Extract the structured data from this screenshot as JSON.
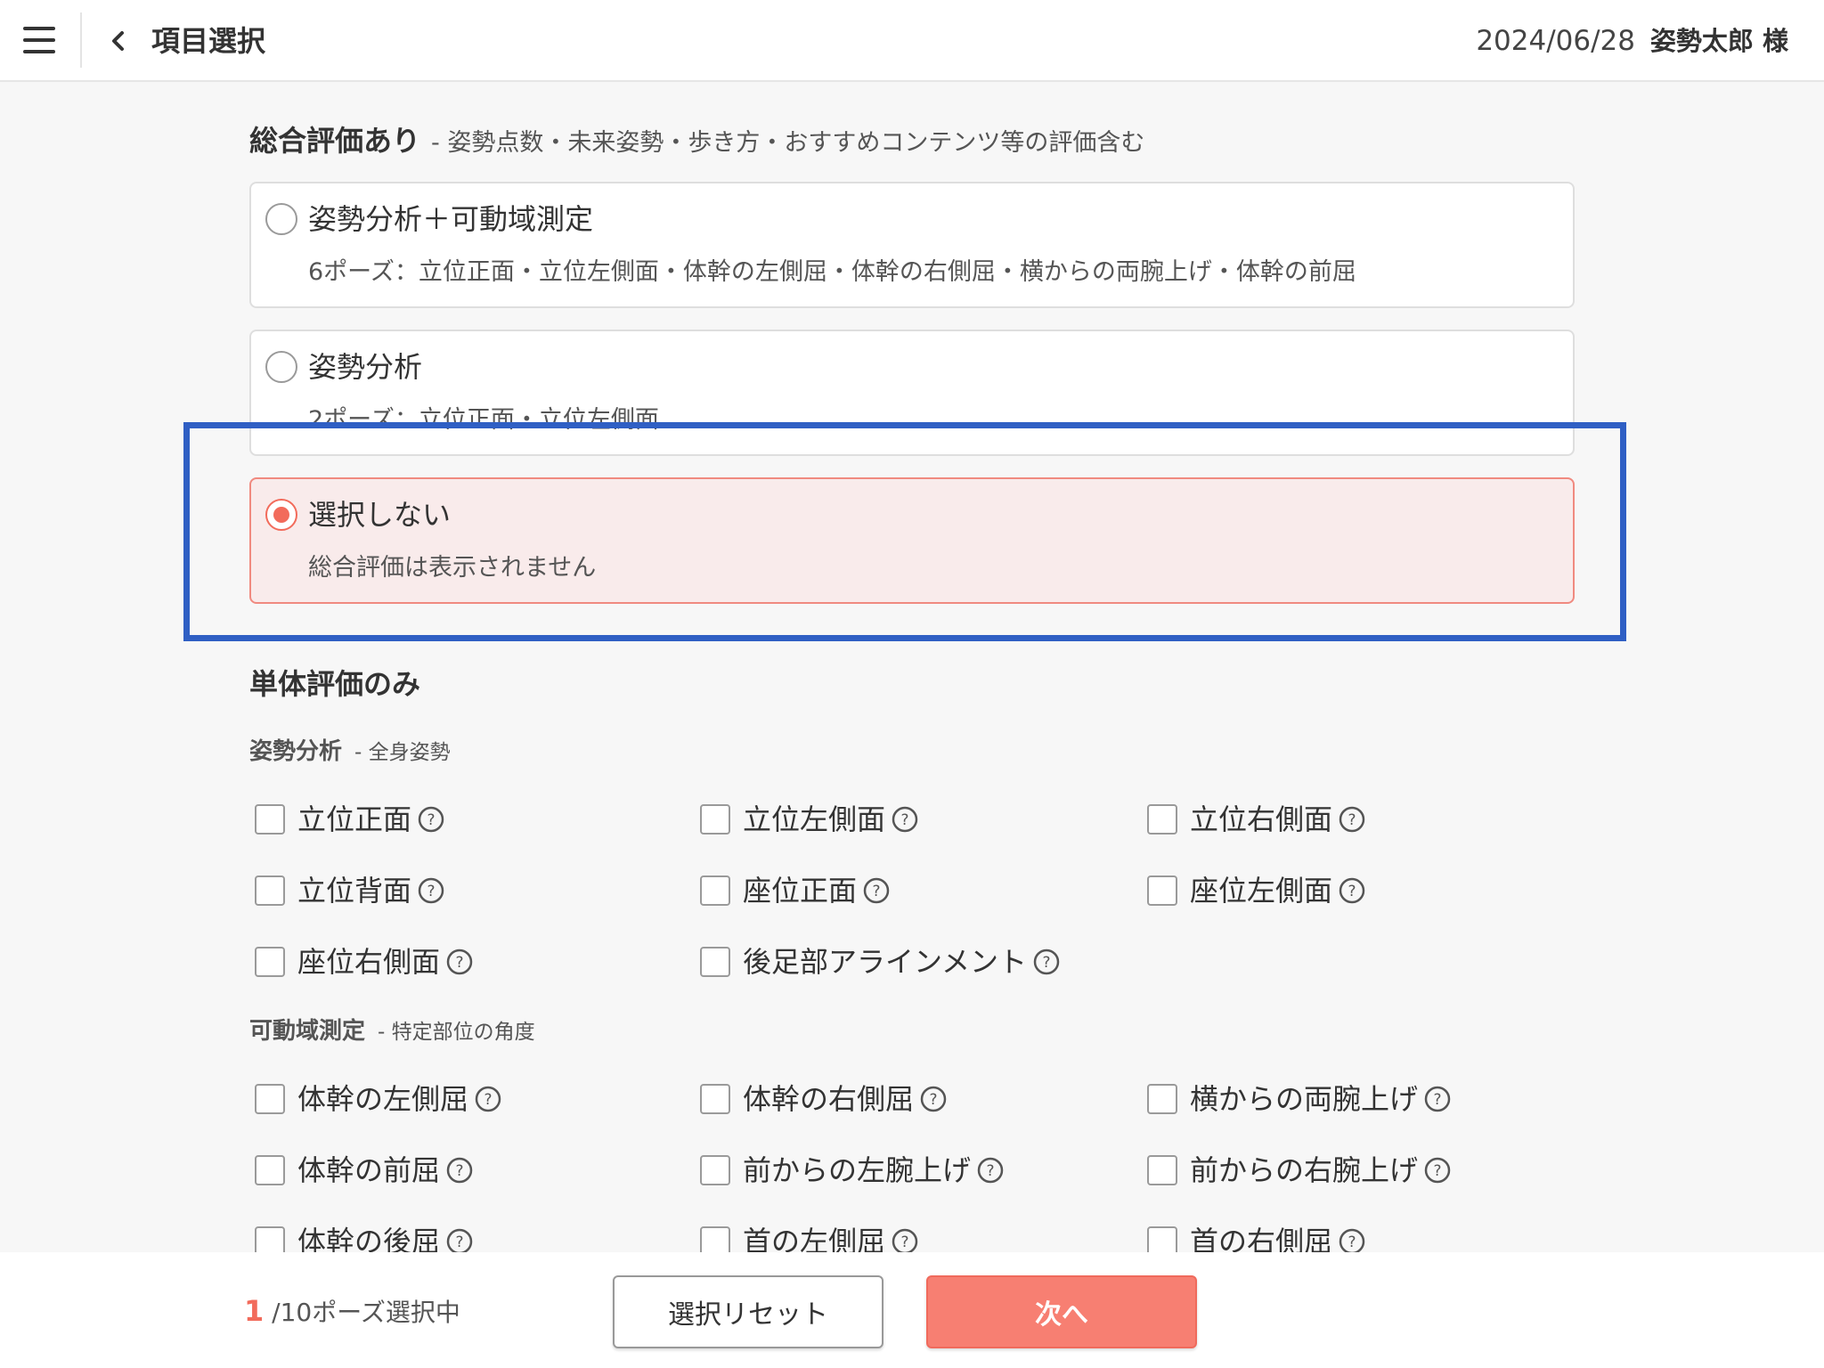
{
  "header": {
    "title": "項目選択",
    "date": "2024/06/28",
    "user": "姿勢太郎 様"
  },
  "overall": {
    "heading": "総合評価あり",
    "subheading": "- 姿勢点数・未来姿勢・歩き方・おすすめコンテンツ等の評価含む",
    "options": [
      {
        "title": "姿勢分析＋可動域測定",
        "desc": "6ポーズ：立位正面・立位左側面・体幹の左側屈・体幹の右側屈・横からの両腕上げ・体幹の前屈",
        "selected": false
      },
      {
        "title": "姿勢分析",
        "desc": "2ポーズ：立位正面・立位左側面",
        "selected": false
      },
      {
        "title": "選択しない",
        "desc": "総合評価は表示されません",
        "selected": true
      }
    ]
  },
  "single": {
    "heading": "単体評価のみ",
    "posture": {
      "label": "姿勢分析",
      "note": "- 全身姿勢",
      "items": [
        "立位正面",
        "立位左側面",
        "立位右側面",
        "立位背面",
        "座位正面",
        "座位左側面",
        "座位右側面",
        "後足部アラインメント"
      ]
    },
    "rom": {
      "label": "可動域測定",
      "note": "- 特定部位の角度",
      "items": [
        "体幹の左側屈",
        "体幹の右側屈",
        "横からの両腕上げ",
        "体幹の前屈",
        "前からの左腕上げ",
        "前からの右腕上げ",
        "体幹の後屈",
        "首の左側屈",
        "首の右側屈"
      ]
    }
  },
  "footer": {
    "count": "1",
    "count_suffix": "/10ポーズ選択中",
    "reset_label": "選択リセット",
    "next_label": "次へ"
  },
  "colors": {
    "accent": "#f26b5b",
    "next_button": "#f77f72",
    "selected_card": "#f9ebeb",
    "highlight_box": "#2f5fc4"
  },
  "icons": [
    "menu-icon",
    "chevron-left-icon",
    "radio-icon",
    "checkbox-icon",
    "help-circle-icon"
  ]
}
